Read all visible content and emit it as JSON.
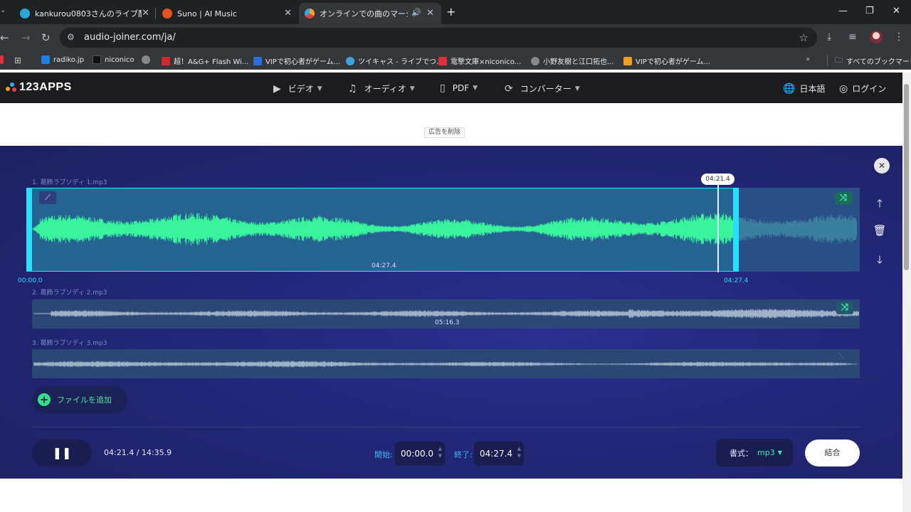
{
  "browser": {
    "tabs": [
      {
        "title": "kankurou0803さんのライブ配信 ·",
        "favicon_color": "#2aa7d9"
      },
      {
        "title": "Suno | AI Music",
        "favicon_color": "#e5531c"
      },
      {
        "title": "オンラインでの曲のマージと mp3",
        "favicon_color": "#f2a03a"
      }
    ],
    "new_tab_label": "+",
    "url": "audio-joiner.com/ja/",
    "bookmarks": [
      {
        "label": "radiko.jp",
        "color": "#2080e0"
      },
      {
        "label": "niconico",
        "color": "#333333"
      },
      {
        "label": "",
        "color": "#888888"
      },
      {
        "label": "超！A&G+ Flash Wi...",
        "color": "#d22a2a"
      },
      {
        "label": "VIPで初心者がゲーム...",
        "color": "#2d6cdf"
      },
      {
        "label": "ツイキャス - ライブでつ...",
        "color": "#3aa3e0"
      },
      {
        "label": "電撃文庫×niconico...",
        "color": "#e0303e"
      },
      {
        "label": "小野友樹と江口拓也...",
        "color": "#888888"
      },
      {
        "label": "VIPで初心者がゲーム...",
        "color": "#f0a020"
      }
    ],
    "all_bookmarks_label": "すべてのブックマーク"
  },
  "site": {
    "logo_text": "123APPS",
    "menu": [
      {
        "label": "ビデオ",
        "icon": "video-icon"
      },
      {
        "label": "オーディオ",
        "icon": "music-note-icon"
      },
      {
        "label": "PDF",
        "icon": "document-icon"
      },
      {
        "label": "コンバーター",
        "icon": "convert-icon"
      }
    ],
    "language": "日本語",
    "login": "ログイン",
    "remove_ad": "広告を削除"
  },
  "editor": {
    "tracks": [
      {
        "label": "1. 葛飾ラプソディ 1.mp3",
        "duration": "04:27.4",
        "start_time": "00:00.0",
        "end_time": "04:27.4"
      },
      {
        "label": "2. 葛飾ラプソディ 2.mp3",
        "duration": "05:16.3"
      },
      {
        "label": "3. 葛飾ラプソディ 3.mp3",
        "duration": ""
      }
    ],
    "playhead_time": "04:21.4",
    "add_file": "ファイルを追加",
    "current_time": "04:21.4 / 14:35.9",
    "start_label": "開始:",
    "start_value": "00:00.0",
    "end_label": "終了:",
    "end_value": "04:27.4",
    "format_label": "書式：",
    "format_value": "mp3",
    "merge_label": "結合"
  },
  "colors": {
    "wave_active": "#39f39d",
    "wave_inactive": "#9fb2c8",
    "accent": "#26e0ff"
  }
}
